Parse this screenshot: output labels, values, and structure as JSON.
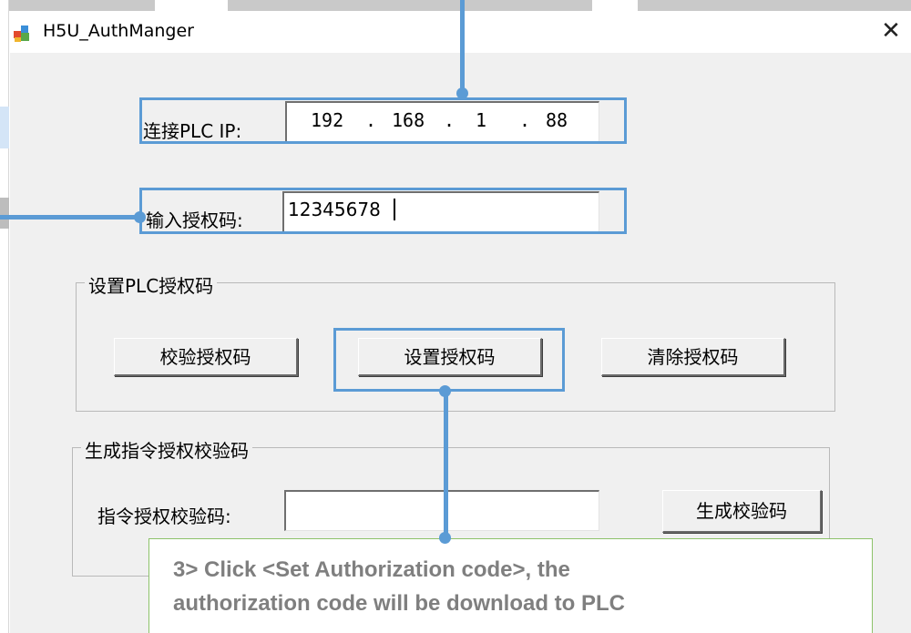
{
  "window": {
    "title": "H5U_AuthManger",
    "close_glyph": "✕",
    "icon": "app-icon"
  },
  "connection": {
    "ip_label": "连接PLC IP:",
    "ip": [
      "192",
      "168",
      "1",
      "88"
    ],
    "ip_dot": "."
  },
  "auth_input": {
    "label": "输入授权码:",
    "value": "12345678"
  },
  "set_group": {
    "title": "设置PLC授权码",
    "buttons": {
      "verify": "校验授权码",
      "set": "设置授权码",
      "clear": "清除授权码"
    }
  },
  "gen_group": {
    "title": "生成指令授权校验码",
    "field_label": "指令授权校验码:",
    "field_value": "",
    "generate_button": "生成校验码"
  },
  "annotation": {
    "line1": "3> Click <Set Authorization code>, the",
    "line2": "authorization code will be download to PLC",
    "highlight_color": "#5b9bd5",
    "callout_border_color": "#8dc26a"
  }
}
